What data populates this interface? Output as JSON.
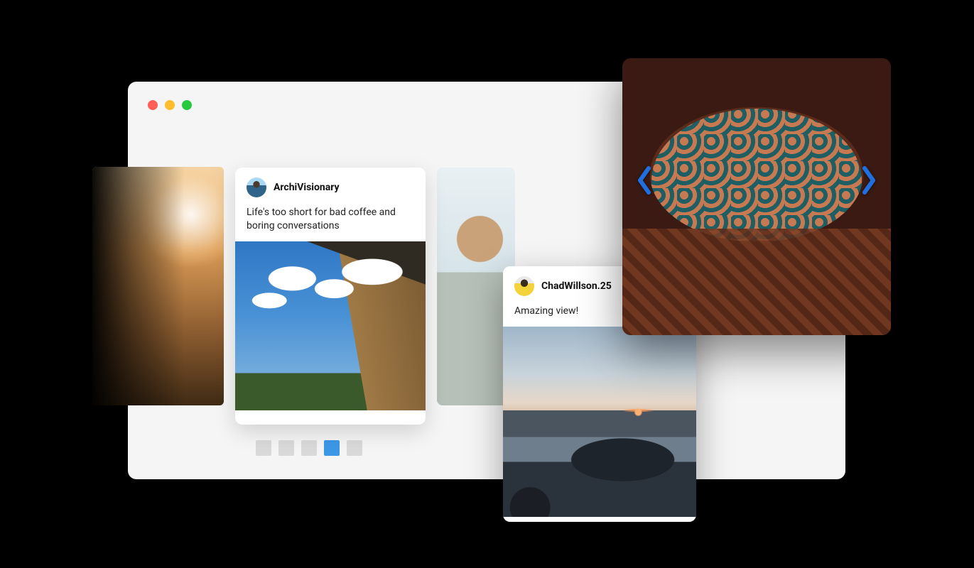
{
  "window": {
    "traffic": {
      "red": "#ff5f57",
      "yellow": "#ffbd2e",
      "green": "#28c840"
    }
  },
  "cards": [
    {
      "username": "ArchiVisionary",
      "caption": "Life's too short for bad coffee and boring conversations"
    },
    {
      "username": "ChadWillson.25",
      "caption": "Amazing view!"
    }
  ],
  "pager": {
    "count": 5,
    "active_index": 3
  },
  "ornate": {
    "nav_left_icon": "chevron-left-icon",
    "nav_right_icon": "chevron-right-icon",
    "arrow_color": "#1f6fe0"
  }
}
